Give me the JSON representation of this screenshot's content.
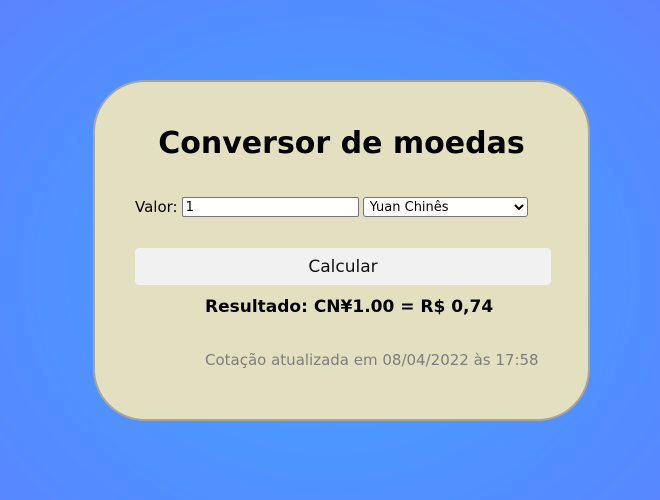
{
  "converter": {
    "title": "Conversor de moedas",
    "amount_label": "Valor:",
    "amount_value": "1",
    "currency_selected": "Yuan Chinês",
    "calculate_label": "Calcular",
    "result_text": "Resultado: CN¥1.00 = R$ 0,74",
    "rate_update_text": "Cotação atualizada em 08/04/2022 às 17:58"
  },
  "colors": {
    "background": "#4f92ff",
    "card_background": "#e3e0c1",
    "card_border": "#a6a6a0",
    "button_background": "#f1f1f1",
    "muted_text": "#7d7d7d"
  }
}
